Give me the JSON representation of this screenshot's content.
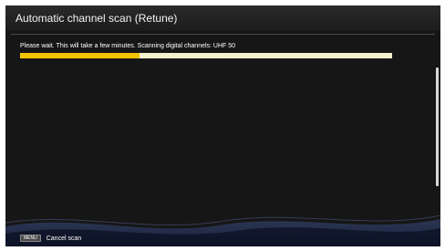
{
  "dialog": {
    "title": "Automatic channel scan (Retune)",
    "message": "Please wait. This will take a few minutes. Scanning digital channels: UHF 50",
    "progress_fraction": 0.32
  },
  "footer": {
    "key_label": "MENU",
    "action_label": "Cancel scan"
  },
  "colors": {
    "background": "#161616",
    "progress_fill": "#f2c400",
    "progress_track": "#f6f1cc"
  }
}
